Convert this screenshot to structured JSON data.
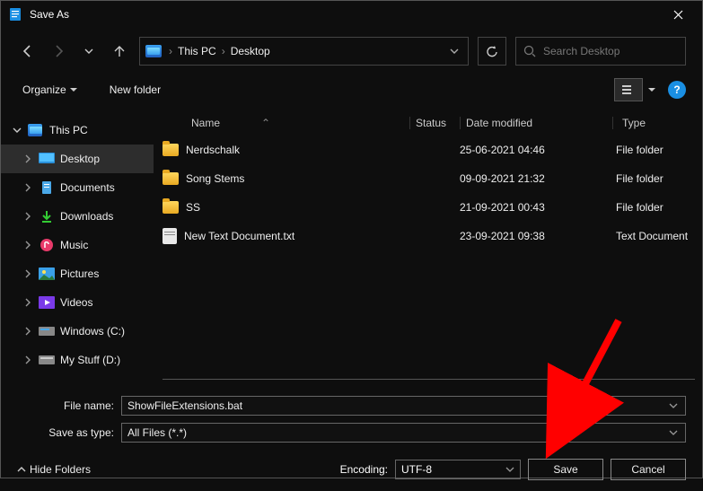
{
  "title": "Save As",
  "breadcrumb": {
    "root": "This PC",
    "current": "Desktop"
  },
  "search_placeholder": "Search Desktop",
  "toolbar": {
    "organize": "Organize",
    "newfolder": "New folder"
  },
  "tree": {
    "root": "This PC",
    "items": [
      {
        "label": "Desktop"
      },
      {
        "label": "Documents"
      },
      {
        "label": "Downloads"
      },
      {
        "label": "Music"
      },
      {
        "label": "Pictures"
      },
      {
        "label": "Videos"
      },
      {
        "label": "Windows (C:)"
      },
      {
        "label": "My Stuff (D:)"
      }
    ]
  },
  "columns": {
    "name": "Name",
    "status": "Status",
    "date": "Date modified",
    "type": "Type"
  },
  "rows": [
    {
      "name": "Nerdschalk",
      "date": "25-06-2021 04:46",
      "type": "File folder",
      "kind": "folder"
    },
    {
      "name": "Song Stems",
      "date": "09-09-2021 21:32",
      "type": "File folder",
      "kind": "folder"
    },
    {
      "name": "SS",
      "date": "21-09-2021 00:43",
      "type": "File folder",
      "kind": "folder"
    },
    {
      "name": "New Text Document.txt",
      "date": "23-09-2021 09:38",
      "type": "Text Document",
      "kind": "txt"
    }
  ],
  "form": {
    "filename_label": "File name:",
    "filename_value": "ShowFileExtensions.bat",
    "type_label": "Save as type:",
    "type_value": "All Files  (*.*)"
  },
  "footer": {
    "hide": "Hide Folders",
    "encoding_label": "Encoding:",
    "encoding_value": "UTF-8",
    "save": "Save",
    "cancel": "Cancel"
  }
}
